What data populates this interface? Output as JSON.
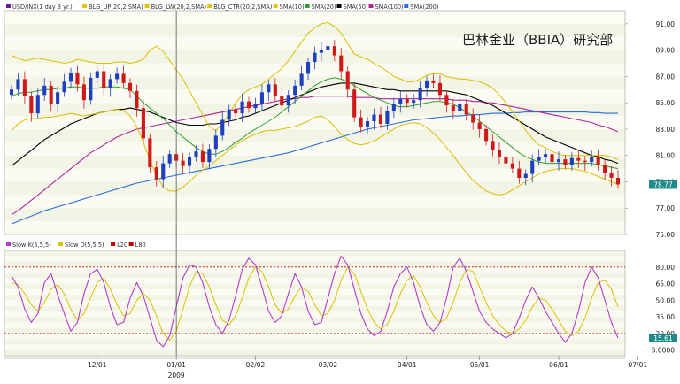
{
  "watermark": "巴林金业（BBIA）研究部",
  "chart_data": [
    {
      "type": "line",
      "panel": "price",
      "legend": [
        {
          "label": "USD/INX(1 day 3 yr.)",
          "color": "#6a1b9a"
        },
        {
          "label": "BLG_UP(20,2,SMA)",
          "color": "#e6c200"
        },
        {
          "label": "BLG_LW(20,2,SMA)",
          "color": "#e6c200"
        },
        {
          "label": "BLG_CTR(20,2,SMA)",
          "color": "#e6c200"
        },
        {
          "label": "SMA(10)",
          "color": "#e6c200"
        },
        {
          "label": "SMA(20)",
          "color": "#2e9e2e"
        },
        {
          "label": "SMA(50)",
          "color": "#000000"
        },
        {
          "label": "SMA(100)",
          "color": "#b0249a"
        },
        {
          "label": "SMA(200)",
          "color": "#2a6fd6"
        }
      ],
      "y_ticks": [
        "91.00",
        "89.00",
        "87.00",
        "85.00",
        "83.00",
        "81.00",
        "79.00",
        "77.00",
        "75.00"
      ],
      "ylim": [
        75,
        92
      ],
      "last_value": "78.77",
      "series": {
        "close": [
          86.0,
          86.8,
          85.5,
          84.2,
          85.6,
          86.3,
          84.9,
          85.8,
          86.6,
          87.3,
          86.4,
          85.2,
          86.9,
          87.4,
          86.1,
          86.8,
          87.2,
          86.5,
          85.9,
          84.6,
          82.3,
          80.1,
          79.2,
          80.4,
          81.1,
          80.6,
          80.2,
          80.9,
          81.3,
          80.5,
          81.5,
          82.5,
          83.7,
          84.5,
          84.2,
          85.1,
          84.6,
          84.9,
          85.8,
          86.4,
          85.5,
          84.8,
          85.6,
          86.3,
          87.2,
          88.1,
          88.8,
          89.0,
          89.3,
          88.6,
          87.4,
          86.0,
          83.9,
          83.2,
          83.6,
          84.1,
          83.4,
          84.4,
          84.9,
          85.3,
          85.0,
          85.2,
          86.1,
          86.7,
          86.5,
          85.6,
          84.8,
          84.4,
          84.9,
          84.1,
          83.5,
          83.0,
          82.1,
          81.4,
          80.9,
          80.4,
          80.0,
          79.3,
          79.6,
          80.6,
          80.9,
          81.1,
          80.5,
          80.7,
          80.3,
          80.8,
          80.6,
          80.5,
          80.9,
          80.3,
          79.7,
          79.3,
          78.8
        ],
        "bb_up": [
          88.6,
          88.4,
          88.2,
          88.3,
          88.4,
          88.3,
          88.2,
          88.1,
          88.0,
          88.1,
          88.3,
          88.2,
          88.1,
          88.0,
          88.0,
          88.0,
          88.1,
          88.1,
          88.0,
          88.1,
          88.3,
          89.0,
          89.3,
          88.9,
          88.2,
          87.5,
          86.8,
          85.9,
          85.0,
          84.1,
          83.2,
          82.9,
          83.4,
          84.2,
          85.0,
          85.6,
          86.0,
          86.2,
          86.4,
          86.8,
          87.2,
          87.6,
          88.2,
          88.9,
          89.6,
          90.3,
          90.7,
          91.0,
          91.1,
          90.8,
          90.3,
          89.5,
          88.7,
          88.5,
          88.3,
          88.0,
          87.7,
          87.4,
          87.0,
          86.8,
          86.6,
          86.6,
          86.8,
          87.1,
          87.2,
          87.2,
          87.0,
          86.9,
          86.8,
          86.8,
          86.7,
          86.6,
          86.4,
          86.1,
          85.6,
          85.0,
          84.3,
          83.6,
          82.9,
          82.3,
          81.8,
          81.6,
          81.3,
          81.1,
          81.0,
          81.0,
          81.0,
          81.0,
          81.0,
          81.0,
          81.0,
          80.9,
          80.7
        ],
        "bb_lw": [
          82.9,
          83.4,
          83.7,
          83.8,
          83.8,
          83.9,
          83.9,
          84.0,
          84.1,
          84.2,
          84.1,
          84.0,
          84.1,
          84.2,
          84.3,
          84.4,
          84.5,
          84.4,
          84.0,
          83.2,
          82.0,
          80.6,
          79.5,
          78.6,
          78.3,
          78.3,
          78.6,
          79.0,
          79.5,
          79.9,
          80.2,
          80.6,
          81.0,
          81.4,
          81.8,
          82.1,
          82.4,
          82.6,
          82.8,
          82.9,
          82.9,
          83.0,
          83.1,
          83.2,
          83.4,
          83.6,
          83.9,
          84.0,
          83.7,
          83.2,
          82.6,
          82.2,
          81.9,
          81.8,
          81.9,
          82.1,
          82.4,
          82.7,
          83.0,
          83.3,
          83.4,
          83.5,
          83.4,
          83.1,
          82.7,
          82.2,
          81.6,
          81.0,
          80.3,
          79.7,
          79.1,
          78.7,
          78.3,
          78.1,
          78.0,
          78.1,
          78.4,
          78.7,
          79.0,
          79.3,
          79.6,
          79.8,
          79.9,
          80.0,
          80.0,
          80.0,
          79.9,
          79.8,
          79.6,
          79.4,
          79.2,
          79.0,
          78.8
        ],
        "sma20": [
          85.5,
          85.7,
          85.8,
          85.8,
          85.9,
          86.0,
          86.0,
          86.1,
          86.1,
          86.2,
          86.2,
          86.1,
          86.1,
          86.1,
          86.2,
          86.2,
          86.2,
          86.1,
          86.0,
          85.5,
          85.0,
          84.6,
          84.2,
          83.8,
          83.3,
          82.8,
          82.4,
          82.0,
          81.6,
          81.3,
          81.1,
          81.1,
          81.3,
          81.6,
          82.0,
          82.3,
          82.7,
          83.0,
          83.3,
          83.6,
          83.9,
          84.3,
          84.7,
          85.1,
          85.5,
          85.9,
          86.3,
          86.6,
          86.8,
          86.9,
          86.8,
          86.6,
          86.3,
          86.0,
          85.7,
          85.4,
          85.2,
          85.0,
          84.8,
          84.7,
          84.7,
          84.8,
          84.9,
          85.0,
          85.1,
          85.1,
          85.0,
          84.9,
          84.6,
          84.3,
          84.0,
          83.6,
          83.2,
          82.8,
          82.4,
          82.0,
          81.6,
          81.2,
          80.9,
          80.7,
          80.5,
          80.4,
          80.4,
          80.4,
          80.4,
          80.4,
          80.4,
          80.4,
          80.4,
          80.3,
          80.2,
          80.1,
          80.0
        ],
        "sma50": [
          80.2,
          80.6,
          81.0,
          81.4,
          81.8,
          82.2,
          82.5,
          82.8,
          83.1,
          83.4,
          83.6,
          83.8,
          84.0,
          84.2,
          84.3,
          84.4,
          84.5,
          84.5,
          84.6,
          84.5,
          84.4,
          84.3,
          84.1,
          83.9,
          83.7,
          83.5,
          83.4,
          83.3,
          83.3,
          83.3,
          83.4,
          83.4,
          83.5,
          83.6,
          83.7,
          83.9,
          84.0,
          84.2,
          84.4,
          84.6,
          84.8,
          85.0,
          85.2,
          85.4,
          85.6,
          85.8,
          86.0,
          86.2,
          86.3,
          86.4,
          86.5,
          86.5,
          86.5,
          86.4,
          86.3,
          86.2,
          86.1,
          86.0,
          86.0,
          85.9,
          85.9,
          85.9,
          85.9,
          85.9,
          85.9,
          85.9,
          85.9,
          85.8,
          85.7,
          85.6,
          85.4,
          85.2,
          85.0,
          84.8,
          84.5,
          84.2,
          83.9,
          83.6,
          83.3,
          83.0,
          82.7,
          82.4,
          82.2,
          82.0,
          81.8,
          81.6,
          81.4,
          81.2,
          81.0,
          80.9,
          80.7,
          80.6,
          80.4
        ],
        "sma100": [
          76.5,
          76.8,
          77.2,
          77.6,
          78.0,
          78.4,
          78.8,
          79.2,
          79.6,
          80.0,
          80.4,
          80.8,
          81.2,
          81.5,
          81.8,
          82.1,
          82.4,
          82.6,
          82.8,
          83.0,
          83.1,
          83.2,
          83.3,
          83.4,
          83.5,
          83.6,
          83.7,
          83.8,
          83.9,
          84.0,
          84.1,
          84.2,
          84.3,
          84.4,
          84.5,
          84.6,
          84.7,
          84.8,
          84.9,
          85.0,
          85.1,
          85.2,
          85.3,
          85.3,
          85.4,
          85.4,
          85.5,
          85.5,
          85.5,
          85.5,
          85.5,
          85.5,
          85.4,
          85.4,
          85.4,
          85.4,
          85.3,
          85.3,
          85.3,
          85.3,
          85.3,
          85.3,
          85.3,
          85.3,
          85.3,
          85.3,
          85.3,
          85.2,
          85.2,
          85.2,
          85.1,
          85.1,
          85.0,
          85.0,
          84.9,
          84.8,
          84.7,
          84.6,
          84.5,
          84.4,
          84.3,
          84.2,
          84.1,
          84.0,
          83.9,
          83.8,
          83.7,
          83.6,
          83.5,
          83.3,
          83.2,
          83.0,
          82.8
        ],
        "sma200": [
          75.8,
          76.0,
          76.2,
          76.4,
          76.6,
          76.8,
          76.95,
          77.1,
          77.25,
          77.4,
          77.55,
          77.7,
          77.85,
          78.0,
          78.15,
          78.3,
          78.45,
          78.6,
          78.75,
          78.9,
          79.0,
          79.1,
          79.2,
          79.3,
          79.4,
          79.5,
          79.6,
          79.7,
          79.8,
          79.9,
          80.0,
          80.1,
          80.2,
          80.3,
          80.4,
          80.5,
          80.6,
          80.7,
          80.8,
          80.9,
          81.0,
          81.1,
          81.2,
          81.35,
          81.5,
          81.65,
          81.8,
          81.95,
          82.1,
          82.25,
          82.4,
          82.55,
          82.7,
          82.85,
          83.0,
          83.1,
          83.2,
          83.3,
          83.4,
          83.5,
          83.6,
          83.7,
          83.75,
          83.8,
          83.85,
          83.9,
          83.95,
          84.0,
          84.0,
          84.05,
          84.1,
          84.1,
          84.15,
          84.2,
          84.2,
          84.2,
          84.25,
          84.25,
          84.3,
          84.3,
          84.3,
          84.3,
          84.3,
          84.3,
          84.3,
          84.3,
          84.3,
          84.3,
          84.25,
          84.25,
          84.2,
          84.2,
          84.2
        ]
      }
    },
    {
      "type": "line",
      "panel": "stochastic",
      "legend": [
        {
          "label": "Slow K(5,5,5)",
          "color": "#b03cc8"
        },
        {
          "label": "Slow D(5,5,5)",
          "color": "#d9c200"
        },
        {
          "label": "L20",
          "color": "#c00000"
        },
        {
          "label": "L80",
          "color": "#c00000"
        }
      ],
      "y_ticks": [
        "80.00",
        "65.00",
        "50.00",
        "35.00",
        "20.00",
        "5.0000"
      ],
      "ylim": [
        0,
        95
      ],
      "levels": [
        20,
        80
      ],
      "last_value": "15.61",
      "series": {
        "k": [
          72,
          62,
          42,
          30,
          38,
          66,
          74,
          55,
          38,
          22,
          30,
          56,
          74,
          78,
          66,
          44,
          28,
          30,
          52,
          66,
          54,
          34,
          14,
          8,
          18,
          44,
          70,
          82,
          80,
          66,
          44,
          28,
          20,
          32,
          54,
          78,
          88,
          82,
          62,
          40,
          30,
          36,
          56,
          74,
          62,
          40,
          28,
          30,
          52,
          74,
          90,
          82,
          60,
          38,
          24,
          18,
          22,
          40,
          62,
          74,
          80,
          66,
          44,
          28,
          22,
          30,
          52,
          80,
          88,
          76,
          58,
          40,
          30,
          24,
          20,
          16,
          20,
          34,
          50,
          62,
          52,
          40,
          30,
          20,
          12,
          20,
          40,
          66,
          80,
          70,
          50,
          30,
          16
        ],
        "d": [
          66,
          64,
          56,
          46,
          40,
          48,
          60,
          64,
          56,
          42,
          32,
          38,
          52,
          66,
          70,
          60,
          46,
          36,
          38,
          50,
          56,
          50,
          36,
          20,
          14,
          22,
          42,
          62,
          76,
          74,
          62,
          46,
          32,
          28,
          36,
          52,
          70,
          80,
          76,
          62,
          46,
          38,
          42,
          54,
          62,
          58,
          46,
          36,
          38,
          50,
          68,
          80,
          74,
          58,
          42,
          30,
          24,
          28,
          40,
          56,
          68,
          72,
          62,
          48,
          36,
          30,
          34,
          48,
          66,
          78,
          76,
          62,
          48,
          36,
          28,
          22,
          20,
          24,
          32,
          44,
          52,
          50,
          42,
          32,
          22,
          18,
          22,
          34,
          52,
          66,
          68,
          60,
          44
        ]
      }
    }
  ],
  "x_axis": {
    "labels": [
      {
        "text": "12/01",
        "idx": 13
      },
      {
        "text": "01/01",
        "idx": 25
      },
      {
        "text": "02/02",
        "idx": 37
      },
      {
        "text": "03/02",
        "idx": 48
      },
      {
        "text": "04/01",
        "idx": 60
      },
      {
        "text": "05/01",
        "idx": 71
      },
      {
        "text": "06/01",
        "idx": 83
      },
      {
        "text": "07/01",
        "idx": 95
      }
    ],
    "year_label": {
      "text": "2009",
      "idx": 25
    },
    "divider_idx": 25
  }
}
